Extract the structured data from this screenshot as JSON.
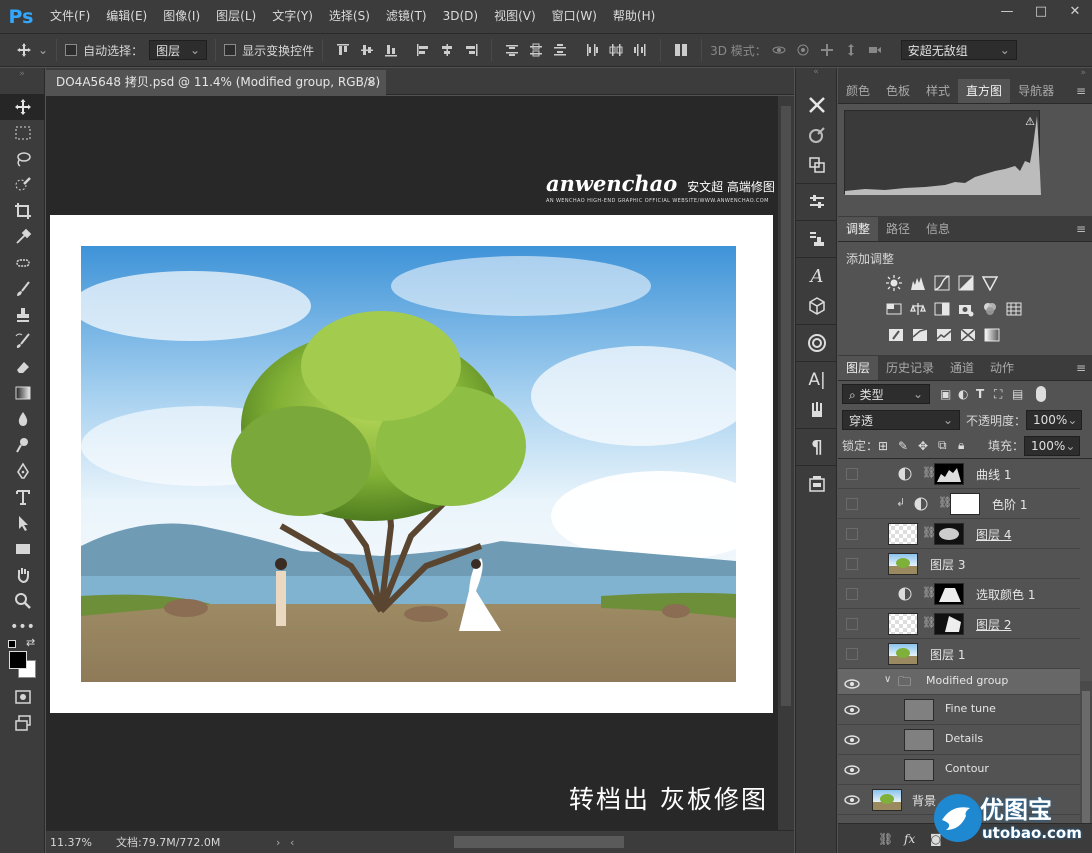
{
  "app": {
    "logo": "Ps"
  },
  "menu": [
    "文件(F)",
    "编辑(E)",
    "图像(I)",
    "图层(L)",
    "文字(Y)",
    "选择(S)",
    "滤镜(T)",
    "3D(D)",
    "视图(V)",
    "窗口(W)",
    "帮助(H)"
  ],
  "window_controls": [
    "—",
    "□",
    "✕"
  ],
  "options": {
    "auto_select_label": "自动选择：",
    "auto_select_value": "图层",
    "show_transform_label": "显示变换控件",
    "mode_3d_label": "3D 模式：",
    "workspace_value": "安超无敌组"
  },
  "document": {
    "tab_title": "DO4A5648 拷贝.psd @ 11.4% (Modified group, RGB/8) *",
    "close": "×",
    "brand_logo": "anwenchao",
    "brand_cn": "安文超 高端修图",
    "brand_sub": "AN WENCHAO HIGH-END GRAPHIC OFFICIAL WEBSITE/WWW.ANWENCHAO.COM",
    "caption": "转档出 灰板修图"
  },
  "status": {
    "zoom": "11.37%",
    "doc_size": "文档:79.7M/772.0M"
  },
  "panels": {
    "top_tabs": [
      "颜色",
      "色板",
      "样式",
      "直方图",
      "导航器"
    ],
    "top_active": "直方图",
    "mid_tabs": [
      "调整",
      "路径",
      "信息"
    ],
    "adjust_title": "添加调整",
    "layer_tabs": [
      "图层",
      "历史记录",
      "通道",
      "动作"
    ],
    "filter_kind": "类型",
    "blend_mode": "穿透",
    "opacity_label": "不透明度：",
    "opacity_value": "100%",
    "lock_label": "锁定：",
    "fill_label": "填充：",
    "fill_value": "100%"
  },
  "layers": [
    {
      "name": "曲线 1",
      "kind": "adjust-curves",
      "visible": false
    },
    {
      "name": "色阶 1",
      "kind": "adjust-levels",
      "visible": false
    },
    {
      "name": "图层 4",
      "kind": "pixel-mask",
      "visible": false
    },
    {
      "name": "图层 3",
      "kind": "pixel",
      "visible": false
    },
    {
      "name": "选取颜色 1",
      "kind": "adjust-selective",
      "visible": false
    },
    {
      "name": "图层 2",
      "kind": "pixel-mask",
      "visible": false
    },
    {
      "name": "图层 1",
      "kind": "pixel",
      "visible": false
    },
    {
      "name": "Modified group",
      "kind": "group",
      "visible": true,
      "selected": true
    },
    {
      "name": "Fine tune",
      "kind": "gray",
      "visible": true
    },
    {
      "name": "Details",
      "kind": "gray",
      "visible": true
    },
    {
      "name": "Contour",
      "kind": "gray",
      "visible": true
    },
    {
      "name": "背景",
      "kind": "pixel",
      "visible": true
    }
  ],
  "footer_icons": [
    "link-icon",
    "fx-icon",
    "mask-icon"
  ],
  "watermark": {
    "text": "优图宝",
    "url": "utobao.com"
  },
  "colors": {
    "accent": "#31a8ff",
    "panel": "#535353",
    "chrome": "#3c3c3c",
    "canvas": "#282828"
  }
}
